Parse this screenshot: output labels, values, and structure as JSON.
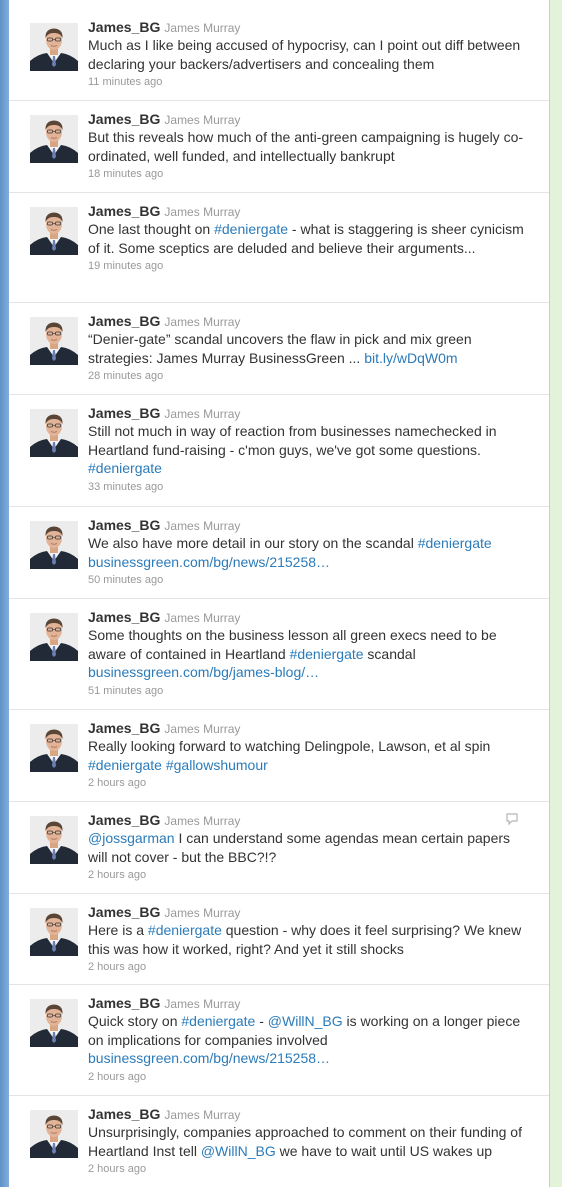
{
  "colors": {
    "link": "#2b7bb9",
    "text": "#333333",
    "muted": "#999999"
  },
  "tweets": [
    {
      "screen_name": "James_BG",
      "real_name": "James Murray",
      "segments": [
        {
          "t": "Much as I like being accused of hypocrisy, can I point out diff between declaring your backers/advertisers and concealing them"
        }
      ],
      "time": "11 minutes ago"
    },
    {
      "screen_name": "James_BG",
      "real_name": "James Murray",
      "segments": [
        {
          "t": "But this reveals how much of the anti-green campaigning is hugely co-ordinated, well funded, and intellectually bankrupt"
        }
      ],
      "time": "18 minutes ago"
    },
    {
      "screen_name": "James_BG",
      "real_name": "James Murray",
      "segments": [
        {
          "t": "One last thought on "
        },
        {
          "t": "#deniergate",
          "link": true
        },
        {
          "t": " - what is staggering is sheer cynicism of it. Some sceptics are deluded and believe their arguments..."
        }
      ],
      "time": "19 minutes ago"
    },
    {
      "screen_name": "James_BG",
      "real_name": "James Murray",
      "segments": [
        {
          "t": "“Denier-gate” scandal uncovers the flaw in pick and mix green strategies: James Murray BusinessGreen ... "
        },
        {
          "t": "bit.ly/wDqW0m",
          "link": true
        }
      ],
      "time": "28 minutes ago"
    },
    {
      "screen_name": "James_BG",
      "real_name": "James Murray",
      "segments": [
        {
          "t": "Still not much in way of reaction from businesses namechecked in Heartland fund-raising - c'mon guys, we've got some questions. "
        },
        {
          "t": "#deniergate",
          "link": true
        }
      ],
      "time": "33 minutes ago"
    },
    {
      "screen_name": "James_BG",
      "real_name": "James Murray",
      "segments": [
        {
          "t": "We also have more detail in our story on the scandal "
        },
        {
          "t": "#deniergate",
          "link": true
        },
        {
          "t": " "
        },
        {
          "t": "businessgreen.com/bg/news/215258…",
          "link": true
        }
      ],
      "time": "50 minutes ago"
    },
    {
      "screen_name": "James_BG",
      "real_name": "James Murray",
      "segments": [
        {
          "t": "Some thoughts on the business lesson all green execs need to be aware of contained in Heartland "
        },
        {
          "t": "#deniergate",
          "link": true
        },
        {
          "t": " scandal "
        },
        {
          "t": "businessgreen.com/bg/james-blog/…",
          "link": true
        }
      ],
      "time": "51 minutes ago"
    },
    {
      "screen_name": "James_BG",
      "real_name": "James Murray",
      "segments": [
        {
          "t": "Really looking forward to watching Delingpole, Lawson, et al spin "
        },
        {
          "t": "#deniergate",
          "link": true
        },
        {
          "t": " "
        },
        {
          "t": "#gallowshumour",
          "link": true
        }
      ],
      "time": "2 hours ago"
    },
    {
      "screen_name": "James_BG",
      "real_name": "James Murray",
      "segments": [
        {
          "t": "@jossgarman",
          "link": true
        },
        {
          "t": " I can understand some agendas mean certain papers will not cover - but the BBC?!?"
        }
      ],
      "time": "2 hours ago"
    },
    {
      "screen_name": "James_BG",
      "real_name": "James Murray",
      "segments": [
        {
          "t": "Here is a "
        },
        {
          "t": "#deniergate",
          "link": true
        },
        {
          "t": " question - why does it feel surprising? We knew this was how it worked, right? And yet it still shocks"
        }
      ],
      "time": "2 hours ago"
    },
    {
      "screen_name": "James_BG",
      "real_name": "James Murray",
      "segments": [
        {
          "t": "Quick story on "
        },
        {
          "t": "#deniergate",
          "link": true
        },
        {
          "t": " - "
        },
        {
          "t": "@WillN_BG",
          "link": true
        },
        {
          "t": " is working on a longer piece on implications for companies involved "
        },
        {
          "t": "businessgreen.com/bg/news/215258…",
          "link": true
        }
      ],
      "time": "2 hours ago"
    },
    {
      "screen_name": "James_BG",
      "real_name": "James Murray",
      "segments": [
        {
          "t": "Unsurprisingly, companies approached to comment on their funding of Heartland Inst tell "
        },
        {
          "t": "@WillN_BG",
          "link": true
        },
        {
          "t": " we have to wait until US wakes up"
        }
      ],
      "time": "2 hours ago"
    }
  ]
}
